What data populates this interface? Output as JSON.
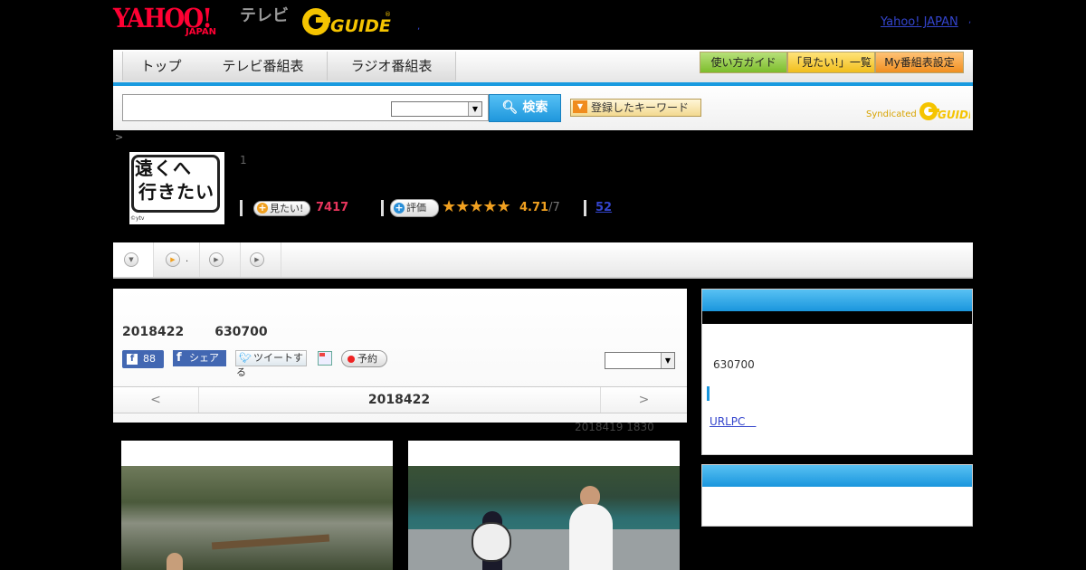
{
  "header": {
    "yahoo_logo_text": "YAHOO!",
    "yahoo_logo_sub": "JAPAN",
    "tv_logo": "テレビ",
    "gguide_logo": "GUIDE",
    "yahoo_japan_link": "Yahoo! JAPAN",
    "small_mark": ","
  },
  "nav": {
    "tabs": [
      {
        "label": "トップ"
      },
      {
        "label": "テレビ番組表"
      },
      {
        "label": "ラジオ番組表"
      }
    ],
    "buttons": [
      {
        "label": "使い方ガイド",
        "color": "#8dc63f"
      },
      {
        "label": "「見たい!」一覧",
        "color": "#f7c325"
      },
      {
        "label": "My番組表設定",
        "color": "#f39a2b"
      }
    ]
  },
  "search": {
    "input_value": "",
    "select_value": "",
    "button_label": "検索",
    "keyword_button": "登録したキーワード",
    "syndicated_text": "Syndicated",
    "syndicated_logo": "GUIDE"
  },
  "program": {
    "breadcrumb_mark": ">",
    "image_text_line1": "遠くへ",
    "image_text_line2": "行きたい",
    "image_credit": "©ytv",
    "episode_number": "1",
    "mitai_label": "見たい!",
    "mitai_count": "7417",
    "rating_label": "評価",
    "stars": "★★★★★",
    "rating_value": "4.71",
    "rating_max": "/7",
    "review_count": "52"
  },
  "subtabs": {
    "items": [
      {
        "label": ""
      },
      {
        "label": "."
      },
      {
        "label": ""
      },
      {
        "label": ""
      }
    ]
  },
  "main": {
    "air_date": "2018422",
    "air_time": "630700",
    "fb_like_count": "88",
    "fb_share_label": "シェア",
    "tweet_label": "ツイートする",
    "reserve_label": "予約",
    "select_value": "",
    "date_nav_prev": "<",
    "date_nav_label": "2018422",
    "date_nav_next": ">",
    "updated_text": "2018419  1830"
  },
  "sidebar": {
    "box1_title": "",
    "air_time": "630700",
    "link_text": "URLPC　",
    "box2_title": ""
  },
  "colors": {
    "accent_blue": "#1a96dd",
    "pink": "#e8355d",
    "orange": "#f0a020"
  }
}
